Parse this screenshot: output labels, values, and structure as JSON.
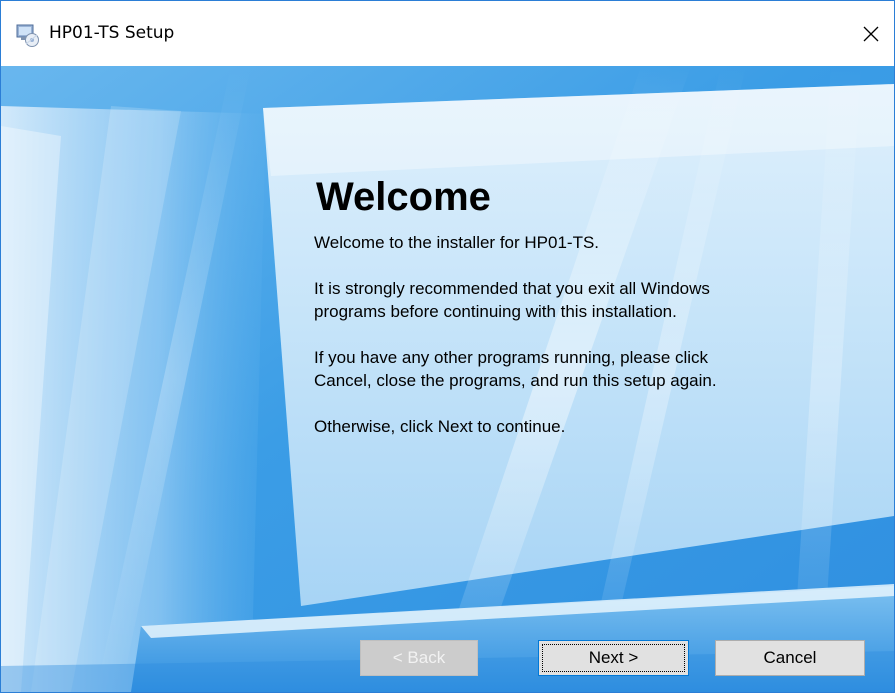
{
  "window": {
    "title": "HP01-TS Setup",
    "close_glyph": "✕"
  },
  "main": {
    "heading": "Welcome",
    "paragraphs": [
      "Welcome to the installer for HP01-TS.",
      "It is strongly recommended that you exit all Windows\nprograms before continuing with this installation.",
      "If you have any other programs running, please click\nCancel, close the programs, and run this setup again.",
      "Otherwise, click Next to continue."
    ]
  },
  "buttons": {
    "back_label": "< Back",
    "next_label": "Next >",
    "cancel_label": "Cancel",
    "back_enabled": false
  },
  "icons": {
    "app": "setup-installer-icon",
    "close": "close-icon"
  },
  "colors": {
    "accent": "#0078d7",
    "background_blue": "#4aa7ea",
    "window_border": "#2b7ed6"
  }
}
